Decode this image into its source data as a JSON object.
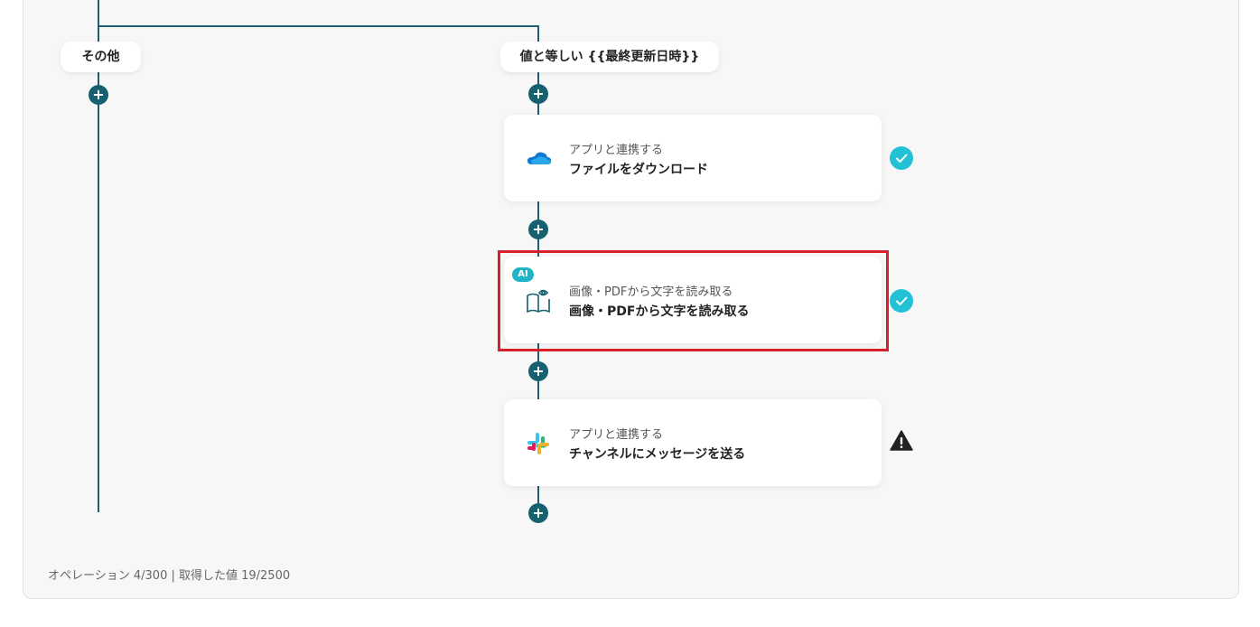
{
  "branches": {
    "left_label": "その他",
    "right_label": "値と等しい {{最終更新日時}}"
  },
  "steps": [
    {
      "ai": false,
      "service": "onedrive-icon",
      "subtitle": "アプリと連携する",
      "title": "ファイルをダウンロード",
      "status": "check"
    },
    {
      "ai": true,
      "ai_label": "AI",
      "service": "book-eye-icon",
      "subtitle": "画像・PDFから文字を読み取る",
      "title": "画像・PDFから文字を読み取る",
      "status": "check",
      "highlighted": true
    },
    {
      "ai": false,
      "service": "slack-icon",
      "subtitle": "アプリと連携する",
      "title": "チャンネルにメッセージを送る",
      "status": "warning"
    }
  ],
  "plus_symbol": "+",
  "colors": {
    "line": "#1f5d73",
    "check": "#22c1d6",
    "highlight": "#d9202a",
    "warning": "#222222"
  },
  "footer": {
    "text": "オペレーション 4/300 | 取得した値 19/2500"
  }
}
